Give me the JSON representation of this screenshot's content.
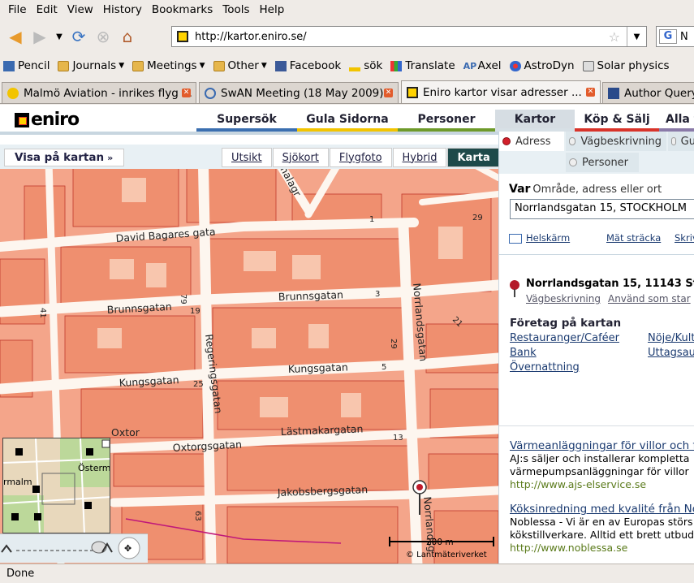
{
  "menubar": {
    "items": [
      "File",
      "Edit",
      "View",
      "History",
      "Bookmarks",
      "Tools",
      "Help"
    ]
  },
  "navbar": {
    "url": "http://kartor.eniro.se/",
    "search_engine_letter": "G",
    "search_text": "N"
  },
  "bookmarks": [
    {
      "label": "Pencil",
      "icon": "pencil-icon",
      "folder": false
    },
    {
      "label": "Journals",
      "icon": "folder-icon",
      "folder": true
    },
    {
      "label": "Meetings",
      "icon": "folder-icon",
      "folder": true
    },
    {
      "label": "Other",
      "icon": "folder-icon",
      "folder": true
    },
    {
      "label": "Facebook",
      "icon": "facebook-icon",
      "folder": false
    },
    {
      "label": "sök",
      "icon": "search-icon",
      "folder": false
    },
    {
      "label": "Translate",
      "icon": "translate-icon",
      "folder": false
    },
    {
      "label": "Axel",
      "icon": "axel-icon",
      "folder": false
    },
    {
      "label": "AstroDyn",
      "icon": "astrodyn-icon",
      "folder": false
    },
    {
      "label": "Solar physics",
      "icon": "globe-icon",
      "folder": false
    }
  ],
  "tabs": [
    {
      "label": "Malmö Aviation - inrikes flyg ...",
      "active": false
    },
    {
      "label": "SwAN Meeting (18 May 2009)",
      "active": false
    },
    {
      "label": "Eniro kartor visar adresser ...",
      "active": true
    },
    {
      "label": "Author Query",
      "active": false
    }
  ],
  "eniro": {
    "logo": "eniro",
    "nav": [
      {
        "label": "Supersök",
        "color": "#3b6fb0"
      },
      {
        "label": "Gula Sidorna",
        "color": "#f2c400"
      },
      {
        "label": "Personer",
        "color": "#6e9a2a"
      },
      {
        "label": "Kartor",
        "color": "#d7e0e6"
      },
      {
        "label": "Köp & Sälj",
        "color": "#d8332a"
      },
      {
        "label": "Alla t",
        "color": "#8a7aa8"
      }
    ]
  },
  "map": {
    "visa_label": "Visa på kartan",
    "types": [
      "Utsikt",
      "Sjökort",
      "Flygfoto",
      "Hybrid",
      "Karta"
    ],
    "active_type": "Karta",
    "streets": [
      "David Bagares gata",
      "Brunnsgatan",
      "Brunnsgatan",
      "Kungsgatan",
      "Kungsgatan",
      "Oxtorgsgatan",
      "Oxtor",
      "Lästmakargatan",
      "Jakobsbergsgatan",
      "Regeringsgatan",
      "Norrlandsgatan",
      "Norrlandsg",
      "malagr"
    ],
    "numbers": [
      "29",
      "1",
      "79",
      "19",
      "3",
      "29",
      "5",
      "21",
      "25",
      "41",
      "13",
      "63"
    ],
    "scale_label": "200 m",
    "copyright": "© Lantmäteriverket",
    "minimap_labels": [
      "Österm",
      "rmalm"
    ]
  },
  "sidebar": {
    "tabs": [
      "Adress",
      "Vägbeskrivning",
      "Gu",
      "Personer"
    ],
    "var_label": "Var",
    "var_hint": "Område, adress eller ort",
    "address_value": "Norrlandsgatan 15, STOCKHOLM",
    "helskarm": "Helskärm",
    "mat_stracka": "Mät sträcka",
    "skriv": "Skriv",
    "result_title": "Norrlandsgatan 15, 11143 St",
    "result_links": [
      "Vägbeskrivning",
      "Använd som star"
    ],
    "foretag_heading": "Företag på kartan",
    "categories": [
      "Restauranger/Caféer",
      "Nöje/Kult",
      "Bank",
      "Uttagsau",
      "Övernattning"
    ],
    "ads": [
      {
        "title": "Värmeanläggningar för villor och f",
        "lines": [
          "AJ:s säljer och installerar kompletta",
          "värmepumpsanläggningar för villor"
        ],
        "url": "http://www.ajs-elservice.se"
      },
      {
        "title": "Köksinredning med kvalité från No",
        "lines": [
          "Noblessa - Vi är en av Europas störs",
          "kökstillverkare. Alltid ett brett utbud"
        ],
        "url": "http://www.noblessa.se"
      }
    ]
  },
  "status": "Done"
}
